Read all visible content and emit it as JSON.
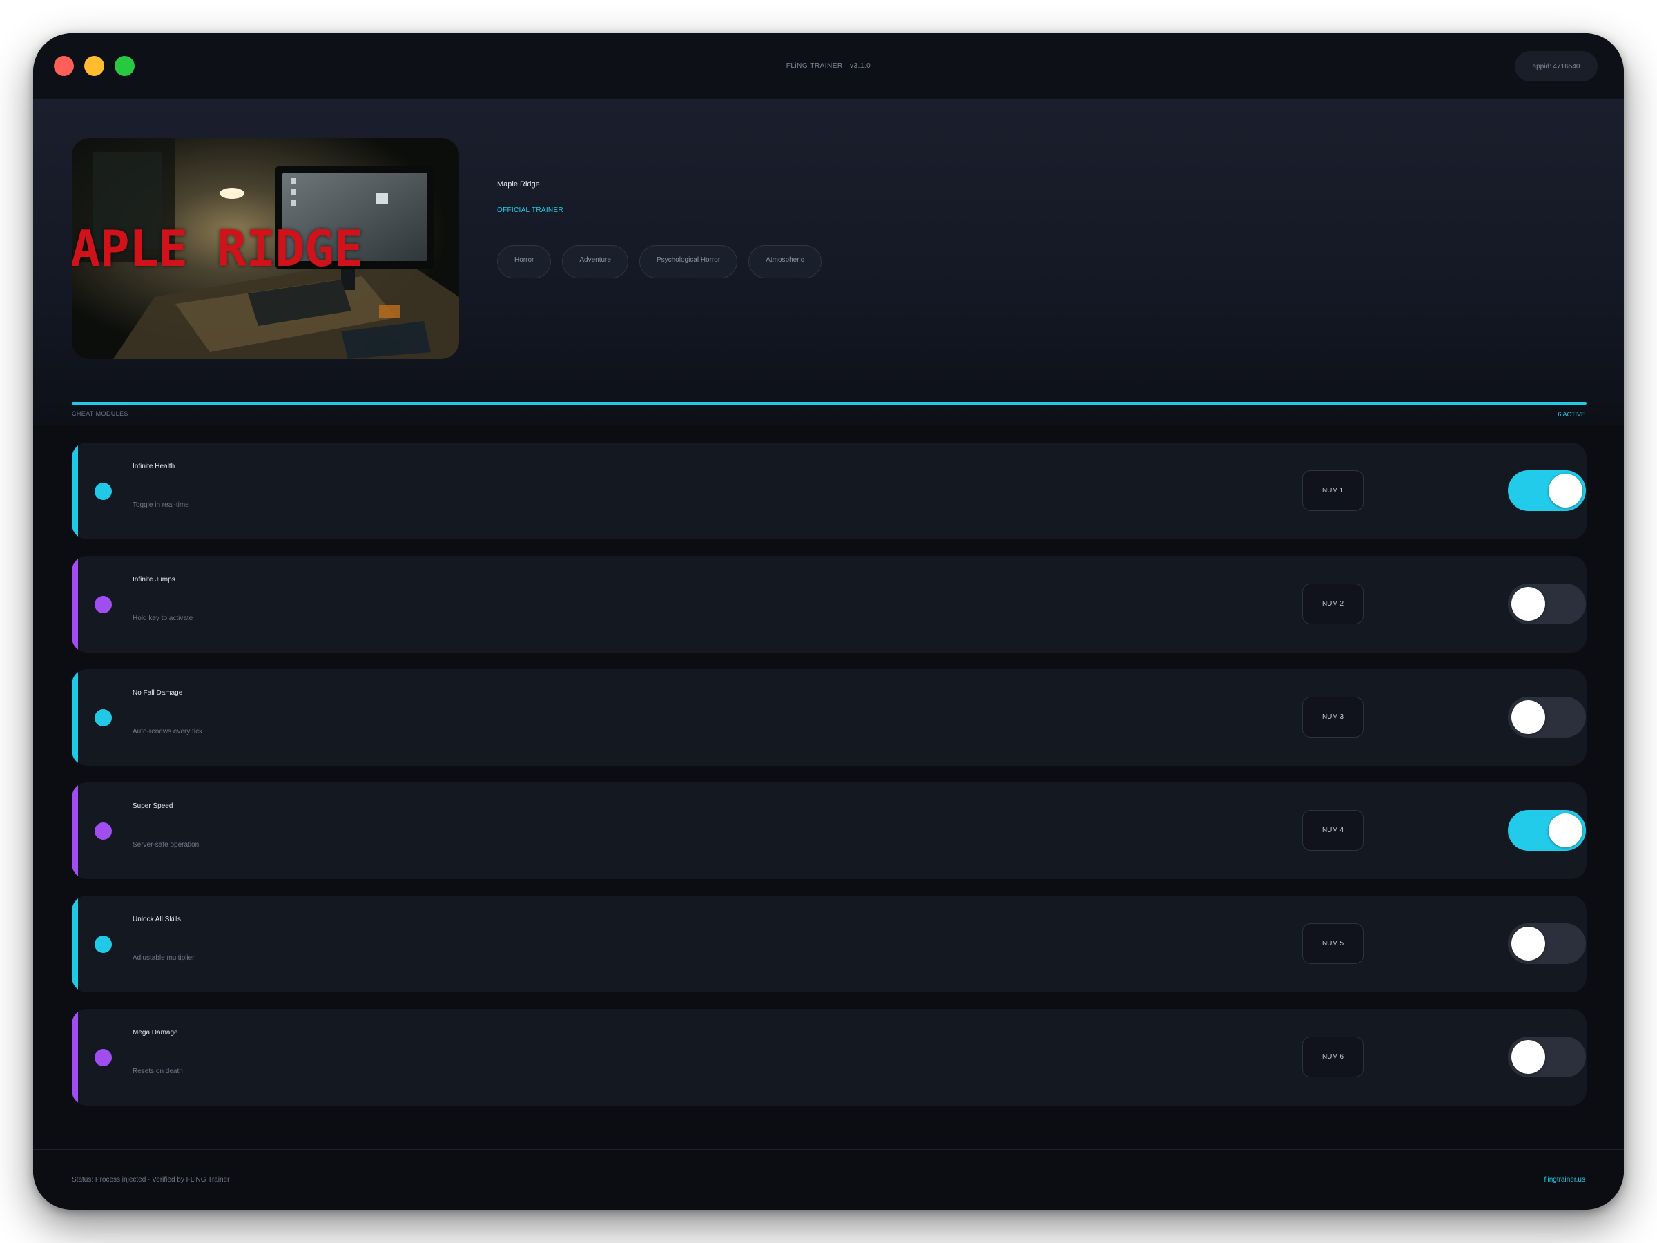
{
  "window": {
    "title": "FLiNG TRAINER · v3.1.0",
    "appid_badge": "appid: 4716540"
  },
  "hero": {
    "cover_text": "APLE RIDGE",
    "game_name": "Maple Ridge",
    "badge": "OFFICIAL TRAINER",
    "tags": [
      "Horror",
      "Adventure",
      "Psychological Horror",
      "Atmospheric"
    ]
  },
  "section": {
    "label": "CHEAT MODULES",
    "active_count": "6 ACTIVE"
  },
  "colors": {
    "accent_cyan": "#22c9e6",
    "accent_purple": "#a14ef0",
    "toggle_on": "#22cbe9",
    "toggle_off": "#2b303c"
  },
  "cheats": [
    {
      "name": "Infinite Health",
      "desc": "Toggle in real-time",
      "hotkey": "NUM 1",
      "accent": "cyan",
      "enabled": true
    },
    {
      "name": "Infinite Jumps",
      "desc": "Hold key to activate",
      "hotkey": "NUM 2",
      "accent": "purple",
      "enabled": false
    },
    {
      "name": "No Fall Damage",
      "desc": "Auto-renews every tick",
      "hotkey": "NUM 3",
      "accent": "cyan",
      "enabled": false
    },
    {
      "name": "Super Speed",
      "desc": "Server-safe operation",
      "hotkey": "NUM 4",
      "accent": "purple",
      "enabled": true
    },
    {
      "name": "Unlock All Skills",
      "desc": "Adjustable multiplier",
      "hotkey": "NUM 5",
      "accent": "cyan",
      "enabled": false
    },
    {
      "name": "Mega Damage",
      "desc": "Resets on death",
      "hotkey": "NUM 6",
      "accent": "purple",
      "enabled": false
    }
  ],
  "footer": {
    "status": "Status: Process injected · Verified by FLiNG Trainer",
    "link": "flingtrainer.us"
  }
}
